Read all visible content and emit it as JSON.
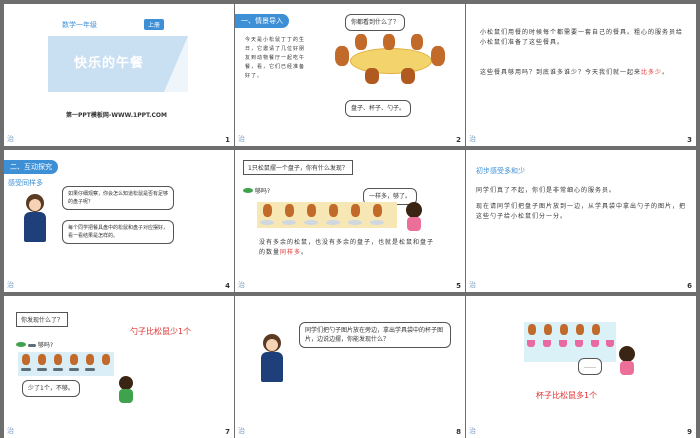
{
  "s1": {
    "grade": "数学一年级",
    "vol": "上册",
    "title": "快乐的午餐",
    "footer": "第一PPT模板网-WWW.1PPT.COM",
    "num": "1"
  },
  "s2": {
    "tag": "一、情景导入",
    "body": "今天是小松鼠丁丁的生日，它邀请了几位好朋友到动物餐厅一起吃午餐，看，它们已经准备好了。",
    "ask": "你都看到什么了？",
    "items": "盘子、杯子、勺子。",
    "num": "2"
  },
  "s3": {
    "p1": "小松鼠们用餐的时候每个都需要一套自己的餐具。粗心的服务员给小松鼠们准备了这些餐具。",
    "p2a": "这些餐具够用吗？到底谁多谁少？今天我们就一起来",
    "p2b": "比多少",
    "p2c": "。",
    "num": "3"
  },
  "s4": {
    "tag": "二、互动探究",
    "sub": "感受同样多",
    "b1": "如果仔细观察，你会怎么知道松鼠是否有足够的盘子呢？",
    "b2": "每个同学把餐具盘中的松鼠和盘子对应摆好，看一看结果是怎样的。",
    "num": "4"
  },
  "s5": {
    "q": "1只松鼠摆一个盘子，你有什么发现？",
    "enough": "够吗?",
    "bubble": "一样多，够了。",
    "body_a": "没有多余的松鼠，也没有多余的盘子，也就是松鼠和盘子的数量",
    "body_b": "同样多",
    "body_c": "。",
    "num": "5"
  },
  "s6": {
    "title": "初步感受多和少",
    "p1": "同学们真了不起，你们是非常细心的服务员。",
    "p2": "现在请同学们把盘子图片放到一边，从学具袋中拿出勺子的图片，把这些勺子给小松鼠们分一分。",
    "num": "6"
  },
  "s7": {
    "q": "你发现什么了？",
    "answer": "勺子比松鼠少1个",
    "enough": "够吗?",
    "bubble": "少了1个，不够。",
    "num": "7"
  },
  "s8": {
    "bubble": "同学们把勺子图片放在旁边，拿出学具袋中的杯子图片，边说边摆，你能发现什么？",
    "num": "8"
  },
  "s9": {
    "bubble": "……",
    "answer": "杯子比松鼠多1个",
    "num": "9"
  },
  "corner": "治"
}
